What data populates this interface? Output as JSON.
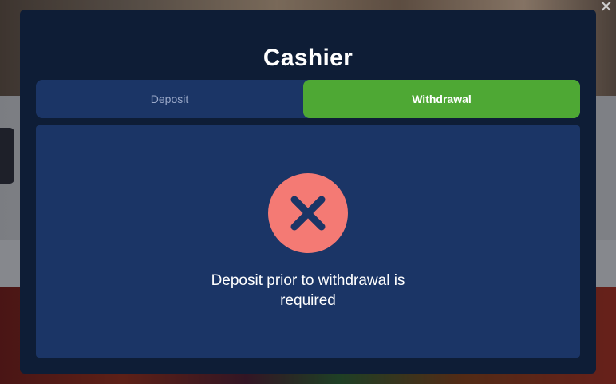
{
  "modal": {
    "title": "Cashier",
    "tabs": [
      {
        "label": "Deposit",
        "active": false
      },
      {
        "label": "Withdrawal",
        "active": true
      }
    ],
    "error_icon": "close-x-icon",
    "message": "Deposit prior to withdrawal is required"
  },
  "colors": {
    "modal_bg": "#0e1d36",
    "panel_bg": "#1b3566",
    "active_tab": "#4ea834",
    "error_circle": "#f47a74"
  }
}
